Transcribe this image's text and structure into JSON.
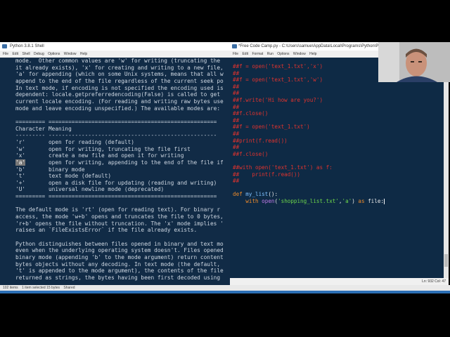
{
  "shell": {
    "title": "Python 3.8.1 Shell",
    "menu": [
      "File",
      "Edit",
      "Shell",
      "Debug",
      "Options",
      "Window",
      "Help"
    ],
    "lines": [
      "mode.  Other common values are 'w' for writing (truncating the",
      "it already exists), 'x' for creating and writing to a new file,",
      "'a' for appending (which on some Unix systems, means that all w",
      "append to the end of the file regardless of the current seek po",
      "In text mode, if encoding is not specified the encoding used is",
      "dependent: locale.getpreferredencoding(False) is called to get",
      "current locale encoding. (For reading and writing raw bytes use",
      "mode and leave encoding unspecified.) The available modes are:",
      "",
      "========= ===================================================",
      "Character Meaning",
      "--------- ---------------------------------------------------",
      "'r'       open for reading (default)",
      "'w'       open for writing, truncating the file first",
      "'x'       create a new file and open it for writing",
      "'a'       open for writing, appending to the end of the file if",
      "'b'       binary mode",
      "'t'       text mode (default)",
      "'+'       open a disk file for updating (reading and writing)",
      "'U'       universal newline mode (deprecated)",
      "========= ===================================================",
      "",
      "The default mode is 'rt' (open for reading text). For binary r",
      "access, the mode 'w+b' opens and truncates the file to 0 bytes,",
      "'r+b' opens the file without truncation. The 'x' mode implies '",
      "raises an `FileExistsError` if the file already exists.",
      "",
      "Python distinguishes between files opened in binary and text mo",
      "even when the underlying operating system doesn't. Files opened",
      "binary mode (appending 'b' to the mode argument) return content",
      "bytes objects without any decoding. In text mode (the default,",
      "'t' is appended to the mode argument), the contents of the file",
      "returned as strings, the bytes having been first decoded using"
    ],
    "highlight_token": "'a'"
  },
  "editor": {
    "title": "*Free Code Camp.py - C:\\Users\\samue\\AppData\\Local\\Programs\\Python\\Python38-",
    "menu": [
      "File",
      "Edit",
      "Format",
      "Run",
      "Options",
      "Window",
      "Help"
    ],
    "comment_lines": [
      "##f = open('text_1.txt','x')",
      "##",
      "##f = open('text_1.txt','w')",
      "##",
      "##",
      "##f.write('Hi how are you?')",
      "##",
      "##f.close()",
      "##",
      "##f = open('text_1.txt')",
      "##",
      "##print(f.read())",
      "##",
      "##f.close()",
      "",
      "##with open('text_1.txt') as f:",
      "##    print(f.read())",
      "##"
    ],
    "code": {
      "def_kw": "def",
      "func_name": "my_list",
      "def_rest": "():",
      "with_kw": "with",
      "open_fn": "open",
      "args_open": "(",
      "arg1": "'shopping_list.txt'",
      "comma": ",",
      "arg2": "'a'",
      "args_close": ")",
      "as_kw": "as",
      "var": "file:"
    },
    "status": "Ln: 932   Col: 47"
  },
  "taskbar": {
    "items": [
      "102 items",
      "1 item selected  15 bytes",
      "Shared"
    ]
  },
  "colors": {
    "editor_bg": "#0e2a45",
    "comment": "#e0332e",
    "keyword": "#f08c2a",
    "string": "#6ed84a",
    "builtin": "#c07ae8",
    "function": "#7ec1ff"
  }
}
